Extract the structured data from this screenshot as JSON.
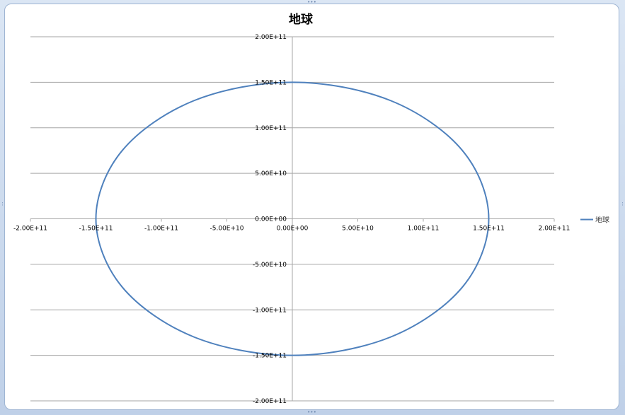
{
  "chart_data": {
    "type": "scatter",
    "title": "地球",
    "xlabel": "",
    "ylabel": "",
    "xlim": [
      -200000000000,
      200000000000
    ],
    "ylim": [
      -200000000000,
      200000000000
    ],
    "x_ticks": [
      "-2.00E+11",
      "-1.50E+11",
      "-1.00E+11",
      "-5.00E+10",
      "0.00E+00",
      "5.00E+10",
      "1.00E+11",
      "1.50E+11",
      "2.00E+11"
    ],
    "y_ticks": [
      "2.00E+11",
      "1.50E+11",
      "1.00E+11",
      "5.00E+10",
      "0.00E+00",
      "-5.00E+10",
      "-1.00E+11",
      "-1.50E+11",
      "-2.00E+11"
    ],
    "grid": "horizontal",
    "legend_position": "right",
    "series": [
      {
        "name": "地球",
        "color": "#4f81bd",
        "x": [
          150000000000,
          129900000000,
          75000000000,
          0,
          -75000000000,
          -129900000000,
          -150000000000,
          -129900000000,
          -75000000000,
          0,
          75000000000,
          129900000000,
          150000000000
        ],
        "y": [
          0,
          75000000000,
          129900000000,
          150000000000,
          129900000000,
          75000000000,
          0,
          -75000000000,
          -129900000000,
          -150000000000,
          -129900000000,
          -75000000000,
          0
        ]
      }
    ]
  }
}
